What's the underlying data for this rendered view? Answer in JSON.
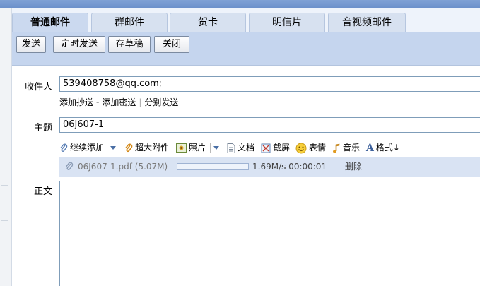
{
  "tabs": [
    {
      "label": "普通邮件",
      "active": true
    },
    {
      "label": "群邮件",
      "active": false
    },
    {
      "label": "贺卡",
      "active": false
    },
    {
      "label": "明信片",
      "active": false
    },
    {
      "label": "音视频邮件",
      "active": false
    }
  ],
  "toolbar": {
    "send": "发送",
    "scheduled_send": "定时发送",
    "save_draft": "存草稿",
    "close": "关闭"
  },
  "form": {
    "recipient_label": "收件人",
    "recipient_value": "539408758@qq.com",
    "recipient_separator": ";",
    "add_cc": "添加抄送",
    "add_bcc": "添加密送",
    "separate_send": "分别发送",
    "subject_label": "主题",
    "subject_value": "06J607-1",
    "body_label": "正文"
  },
  "attach_tools": {
    "continue_add": "继续添加",
    "large_attachment": "超大附件",
    "photo": "照片",
    "document": "文档",
    "screenshot": "截屏",
    "emoticon": "表情",
    "music": "音乐",
    "format": "格式↓"
  },
  "upload": {
    "file_name": "06J607-1.pdf (5.07M)",
    "progress": 0.0,
    "speed": "1.69M/s 00:00:01",
    "delete": "删除"
  },
  "colors": {
    "tab_bg": "#d7e1f0",
    "toolbar_bg": "#c5d5ee",
    "upload_bg": "#d9e3f3",
    "field_border": "#7f9db9"
  }
}
